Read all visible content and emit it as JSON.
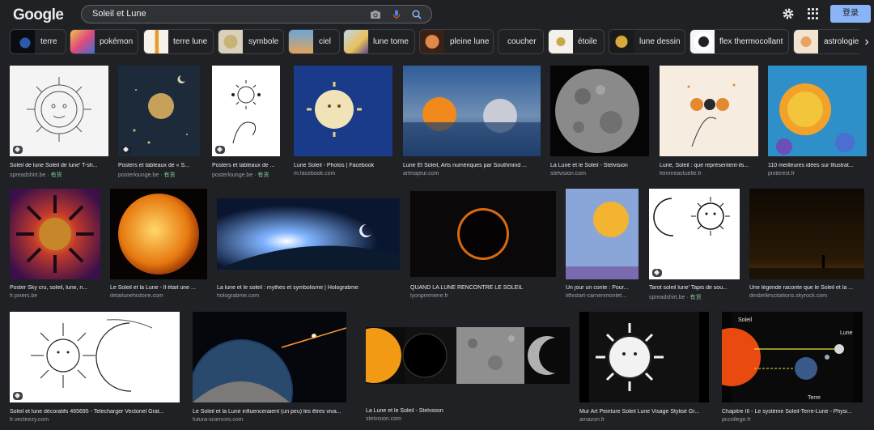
{
  "logo": {
    "letters": [
      "G",
      "o",
      "o",
      "g",
      "l",
      "e"
    ],
    "colors": [
      "#e8eaed",
      "#e8eaed",
      "#e8eaed",
      "#e8eaed",
      "#e8eaed",
      "#e8eaed"
    ]
  },
  "search": {
    "query": "Soleil et Lune",
    "icons": [
      "camera-icon",
      "mic-icon",
      "search-icon"
    ]
  },
  "header": {
    "signin_label": "登录",
    "settings_icon": "gear-icon",
    "apps_icon": "apps-grid-icon"
  },
  "chips": [
    {
      "label": "terre",
      "has_thumb": true
    },
    {
      "label": "pokémon",
      "has_thumb": true
    },
    {
      "label": "terre lune",
      "has_thumb": true
    },
    {
      "label": "symbole",
      "has_thumb": true
    },
    {
      "label": "ciel",
      "has_thumb": true
    },
    {
      "label": "lune tome",
      "has_thumb": true
    },
    {
      "label": "pleine lune",
      "has_thumb": true
    },
    {
      "label": "coucher",
      "has_thumb": false
    },
    {
      "label": "étoile",
      "has_thumb": true
    },
    {
      "label": "lune dessin",
      "has_thumb": true
    },
    {
      "label": "flex thermocollant",
      "has_thumb": true
    },
    {
      "label": "astrologie",
      "has_thumb": true
    }
  ],
  "results": [
    {
      "title": "Soleil de lune Soleil de lune' T-sh...",
      "source": "spreadshirt.be",
      "badge": "有货"
    },
    {
      "title": "Posters et tableaux de « S...",
      "source": "posterlounge.be",
      "badge": "有货"
    },
    {
      "title": "Posters et tableaux de ...",
      "source": "posterlounge.be",
      "badge": "有货"
    },
    {
      "title": "Lune Soleil - Photos | Facebook",
      "source": "m.facebook.com",
      "badge": ""
    },
    {
      "title": "Lune Et Soleil, Arts numériques par Southmind ...",
      "source": "artmajeur.com",
      "badge": ""
    },
    {
      "title": "La Lune et le Soleil - Stelvision",
      "source": "stelvision.com",
      "badge": ""
    },
    {
      "title": "Lune, Soleil : que représentent-ils...",
      "source": "femmeactuelle.fr",
      "badge": ""
    },
    {
      "title": "110 meilleures idées sur Illustrat...",
      "source": "pinterest.fr",
      "badge": ""
    },
    {
      "title": "Poster Sky cru, soleil, lune, n...",
      "source": "fr.pixers.be",
      "badge": ""
    },
    {
      "title": "Le Soleil et la Lune - Il était une ...",
      "source": "iletaitunehistoire.com",
      "badge": ""
    },
    {
      "title": "La lune et le soleil : mythes et symbolisme | Holograbme",
      "source": "holograbme.com",
      "badge": ""
    },
    {
      "title": "QUAND LA LUNE RENCONTRE LE SOLEIL",
      "source": "lyonpremiere.fr",
      "badge": ""
    },
    {
      "title": "Un jour un conte : Pour...",
      "source": "lithistart-carnenmontet...",
      "badge": ""
    },
    {
      "title": "Tarot soleil lune' Tapis de sou...",
      "source": "spreadshirt.be",
      "badge": "有货"
    },
    {
      "title": "Une légende raconte que le Soleil et la ...",
      "source": "desbellescitations.skyrock.com",
      "badge": ""
    },
    {
      "title": "Soleil et lune décoratifs 465695 - Telecharger Vectoriel Grat...",
      "source": "fr.vecteezy.com",
      "badge": ""
    },
    {
      "title": "Le Soleil et la Lune influenceraient (un peu) les êtres viva...",
      "source": "futura-sciences.com",
      "badge": ""
    },
    {
      "title": "La Lune et le Soleil - Stelvision",
      "source": "stelvision.com",
      "badge": ""
    },
    {
      "title": "Mur Art Peinture Soleil Lune Visage Stylisé Gr...",
      "source": "amazon.fr",
      "badge": ""
    },
    {
      "title": "Chapitre III - Le système Soleil-Terre-Lune - Physi...",
      "source": "pccollege.fr",
      "badge": ""
    }
  ],
  "diagram_labels": {
    "soleil": "Soleil",
    "lune": "Lune",
    "terre": "Terre"
  },
  "nav": {
    "next_arrow": "›"
  }
}
